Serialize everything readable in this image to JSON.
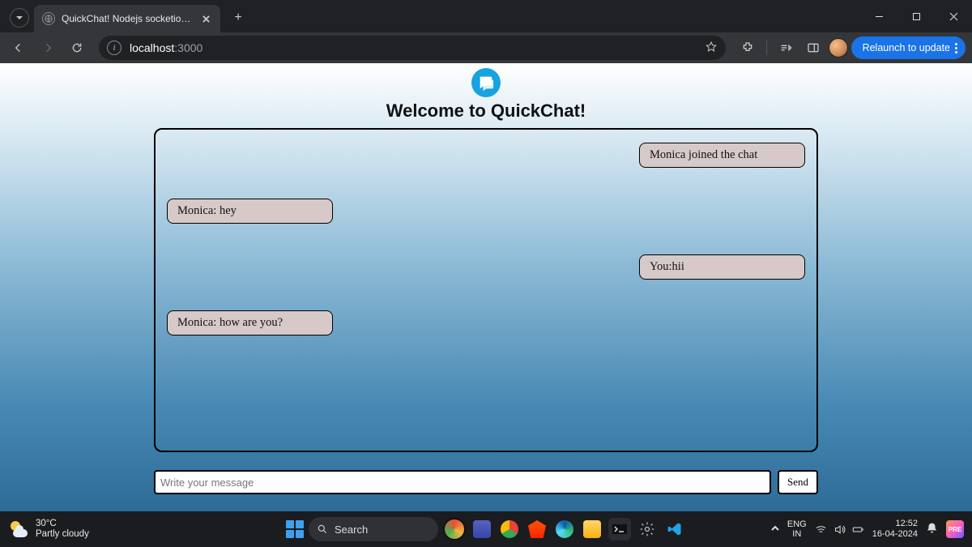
{
  "browser": {
    "tab_title": "QuickChat! Nodejs socketio ch…",
    "url_host": "localhost",
    "url_port": ":3000",
    "relaunch_label": "Relaunch to update"
  },
  "app": {
    "heading": "Welcome to QuickChat!",
    "messages": [
      {
        "side": "right",
        "text": "Monica joined the chat"
      },
      {
        "side": "left",
        "text": "Monica: hey"
      },
      {
        "side": "right",
        "text": "You:hii"
      },
      {
        "side": "left",
        "text": "Monica:  how are you?"
      }
    ],
    "input_placeholder": "Write your message",
    "send_label": "Send"
  },
  "taskbar": {
    "temp": "30°C",
    "weather": "Partly cloudy",
    "search_placeholder": "Search",
    "lang1": "ENG",
    "lang2": "IN",
    "time": "12:52",
    "date": "16-04-2024",
    "pre": "PRE"
  }
}
